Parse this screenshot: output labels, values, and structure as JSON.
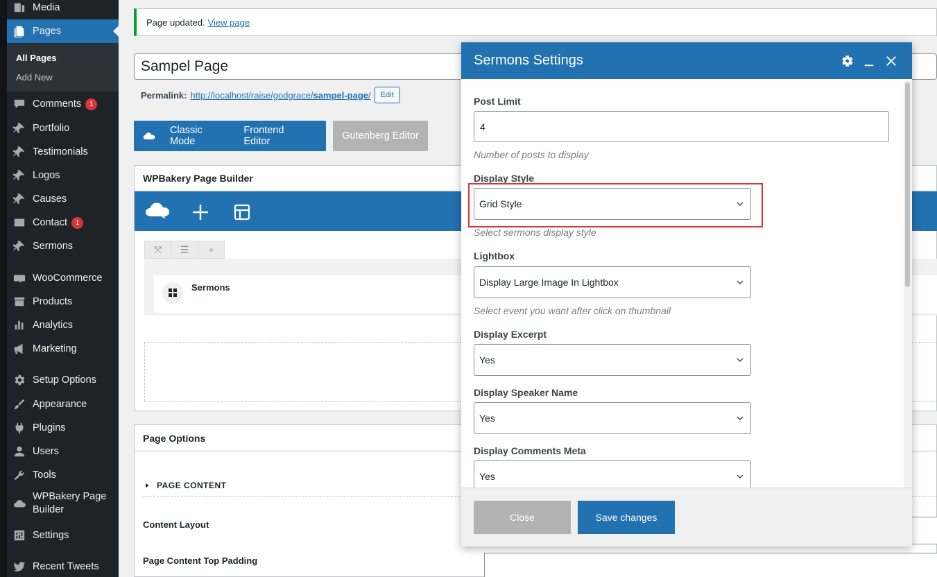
{
  "sidebar": {
    "items": [
      {
        "label": "Media",
        "icon": "media-icon"
      },
      {
        "label": "Pages",
        "icon": "pages-icon"
      },
      {
        "label": "Comments",
        "icon": "comments-icon",
        "badge": "1"
      },
      {
        "label": "Portfolio",
        "icon": "pin-icon"
      },
      {
        "label": "Testimonials",
        "icon": "pin-icon"
      },
      {
        "label": "Logos",
        "icon": "pin-icon"
      },
      {
        "label": "Causes",
        "icon": "pin-icon"
      },
      {
        "label": "Contact",
        "icon": "mail-icon",
        "badge": "1"
      },
      {
        "label": "Sermons",
        "icon": "pin-icon"
      },
      {
        "label": "WooCommerce",
        "icon": "woo-icon"
      },
      {
        "label": "Products",
        "icon": "archive-icon"
      },
      {
        "label": "Analytics",
        "icon": "chart-bar-icon"
      },
      {
        "label": "Marketing",
        "icon": "megaphone-icon"
      },
      {
        "label": "Setup Options",
        "icon": "gear-icon"
      },
      {
        "label": "Appearance",
        "icon": "brush-icon"
      },
      {
        "label": "Plugins",
        "icon": "plug-icon"
      },
      {
        "label": "Users",
        "icon": "user-icon"
      },
      {
        "label": "Tools",
        "icon": "wrench-icon"
      },
      {
        "label": "WPBakery Page Builder",
        "icon": "cloud-icon"
      },
      {
        "label": "Settings",
        "icon": "sliders-icon"
      },
      {
        "label": "Recent Tweets",
        "icon": "twitter-icon"
      }
    ],
    "submenu": [
      "All Pages",
      "Add New"
    ]
  },
  "notice": {
    "text": "Page updated.",
    "link": "View page"
  },
  "editor": {
    "title": "Sampel Page",
    "permalink_label": "Permalink:",
    "permalink_base": "http://localhost/raise/godgrace/",
    "permalink_slug": "sampel-page",
    "permalink_end": "/",
    "edit_label": "Edit",
    "modes": [
      "Classic Mode",
      "Frontend Editor"
    ],
    "gutenberg": "Gutenberg Editor"
  },
  "wpbakery": {
    "header": "WPBakery Page Builder",
    "element_name": "Sermons"
  },
  "page_options": {
    "header": "Page Options",
    "section": "PAGE CONTENT",
    "content_layout": "Content Layout",
    "top_padding": "Page Content Top Padding"
  },
  "modal": {
    "title": "Sermons Settings",
    "fields": {
      "post_limit": {
        "label": "Post Limit",
        "value": "4",
        "hint": "Number of posts to display"
      },
      "display_style": {
        "label": "Display Style",
        "value": "Grid Style",
        "hint": "Select sermons display style"
      },
      "lightbox": {
        "label": "Lightbox",
        "value": "Display Large Image In Lightbox",
        "hint": "Select event you want after click on thumbnail"
      },
      "excerpt": {
        "label": "Display Excerpt",
        "value": "Yes"
      },
      "speaker": {
        "label": "Display Speaker Name",
        "value": "Yes"
      },
      "comments_meta": {
        "label": "Display Comments Meta",
        "value": "Yes"
      }
    },
    "close_label": "Close",
    "save_label": "Save changes"
  },
  "colors": {
    "wp_blue": "#2271b1",
    "sidebar_bg": "#1d2327",
    "highlight": "#d63638",
    "badge": "#d63638"
  }
}
